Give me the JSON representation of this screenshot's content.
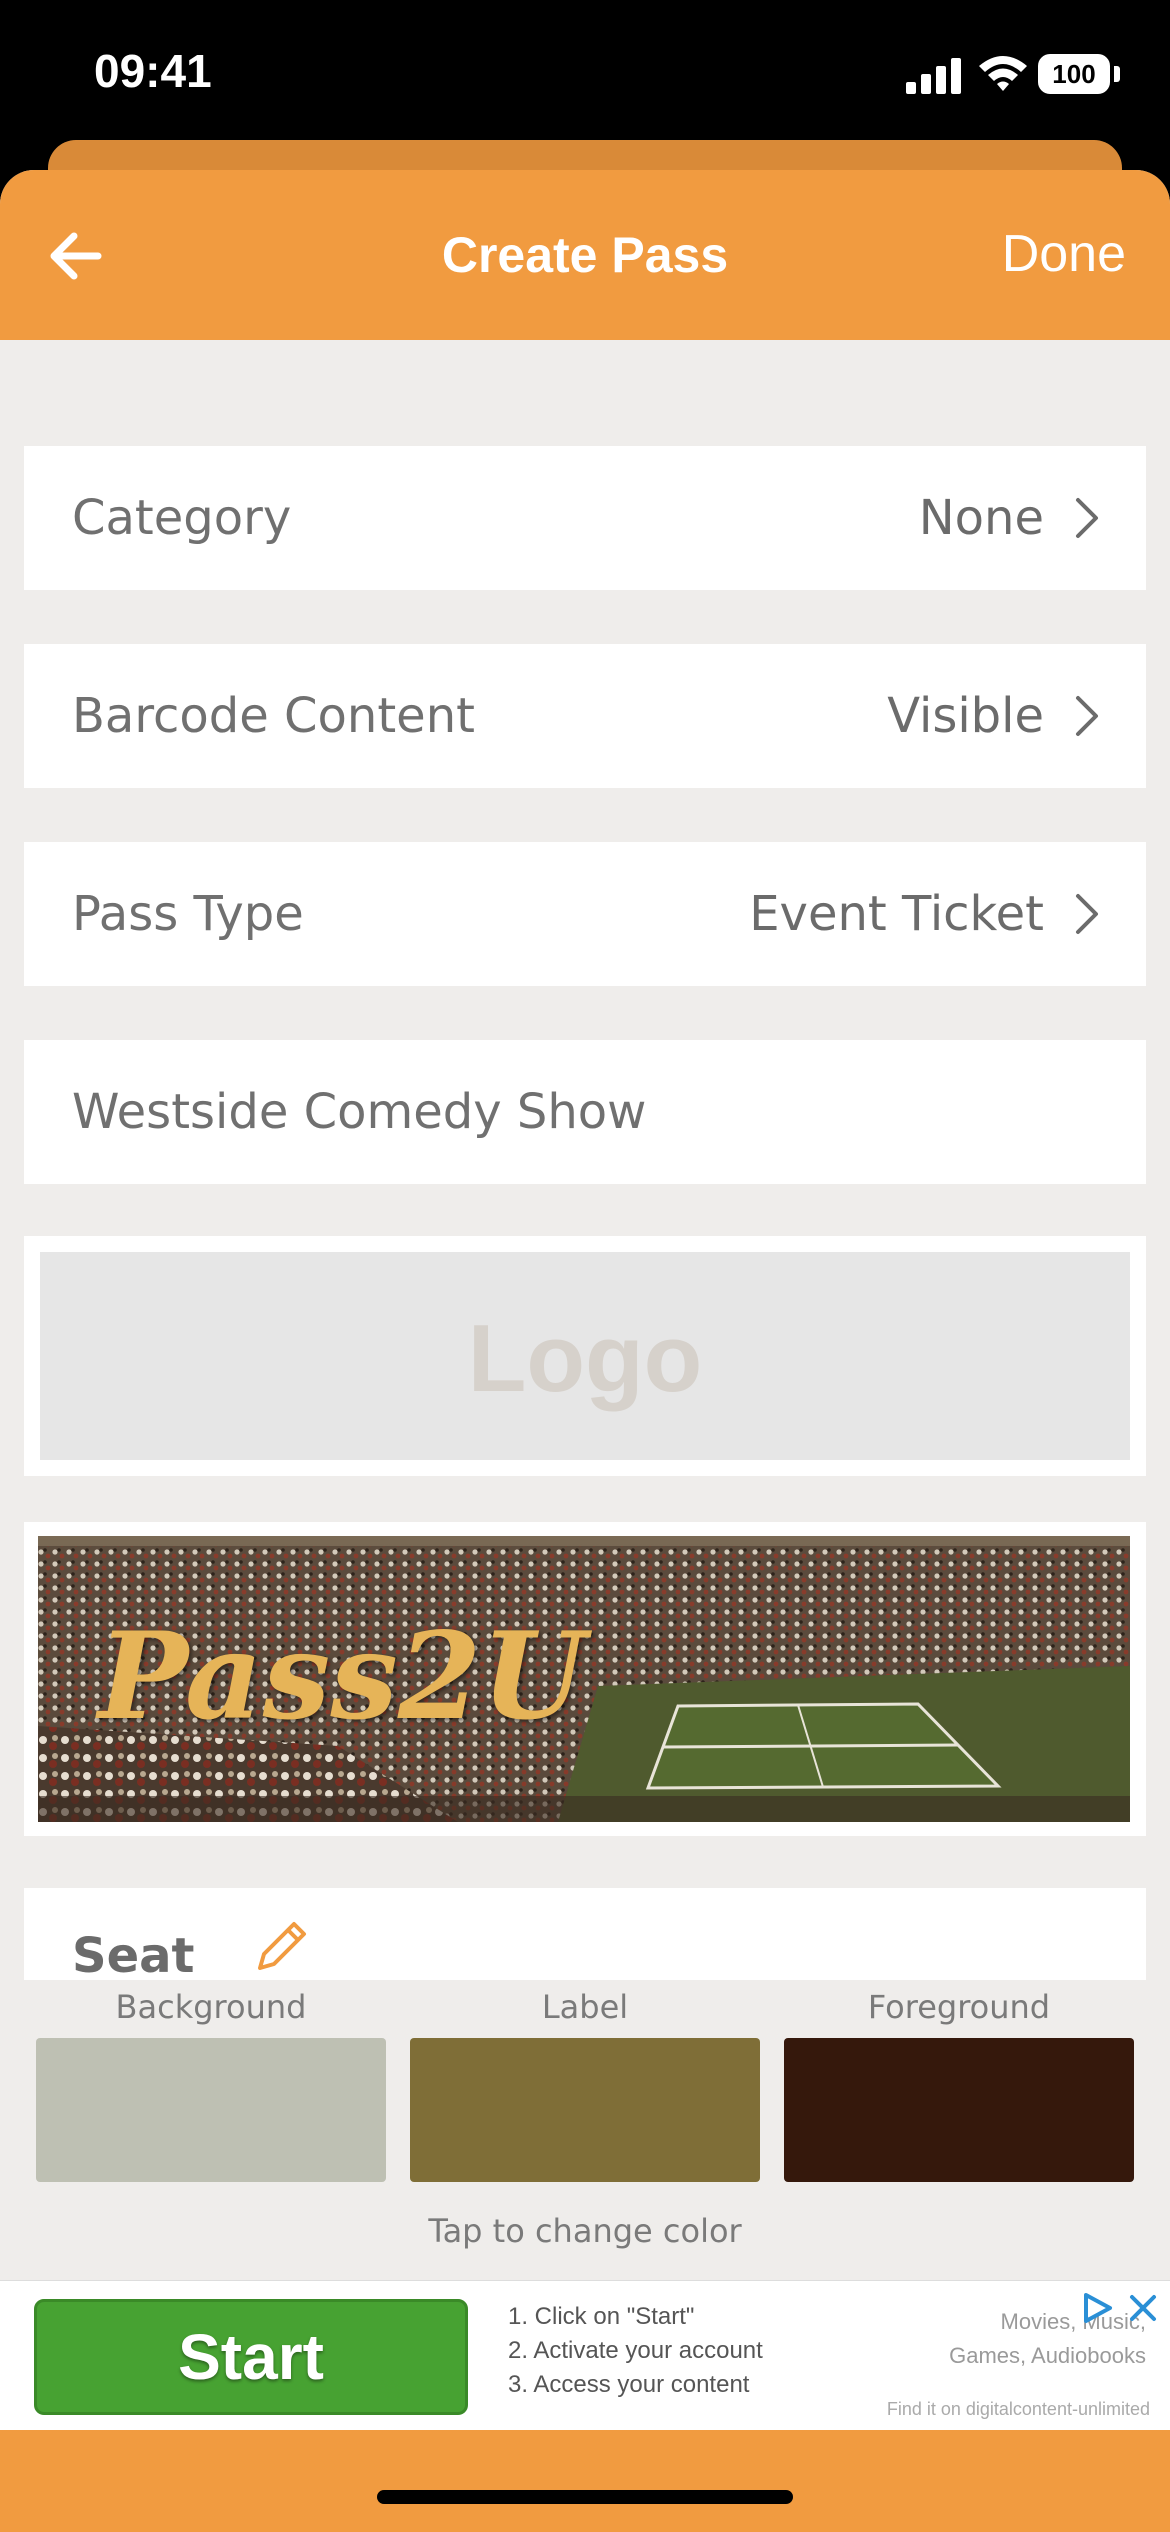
{
  "status_bar": {
    "time": "09:41",
    "battery": "100"
  },
  "nav": {
    "title": "Create Pass",
    "done_label": "Done"
  },
  "rows": [
    {
      "label": "Category",
      "value": "None"
    },
    {
      "label": "Barcode Content",
      "value": "Visible"
    },
    {
      "label": "Pass Type",
      "value": "Event Ticket"
    }
  ],
  "event_name": {
    "value": "Westside Comedy Show"
  },
  "logo": {
    "placeholder": "Logo"
  },
  "banner": {
    "brand_text": "Pass2U"
  },
  "seat": {
    "title": "Seat"
  },
  "colors": {
    "items": [
      {
        "label": "Background",
        "hex": "#bec0b3"
      },
      {
        "label": "Label",
        "hex": "#7f6e37"
      },
      {
        "label": "Foreground",
        "hex": "#35180c"
      }
    ],
    "hint": "Tap to change color"
  },
  "ad": {
    "button_label": "Start",
    "steps": [
      "1. Click on \"Start\"",
      "2. Activate your account",
      "3. Access your content"
    ],
    "right_line1": "Movies, Music,",
    "right_line2": "Games, Audiobooks",
    "fine_print": "Find it on digitalcontent-unlimited"
  },
  "theme": {
    "accent": "#f19b40",
    "sheet_bg": "#efedeb"
  }
}
